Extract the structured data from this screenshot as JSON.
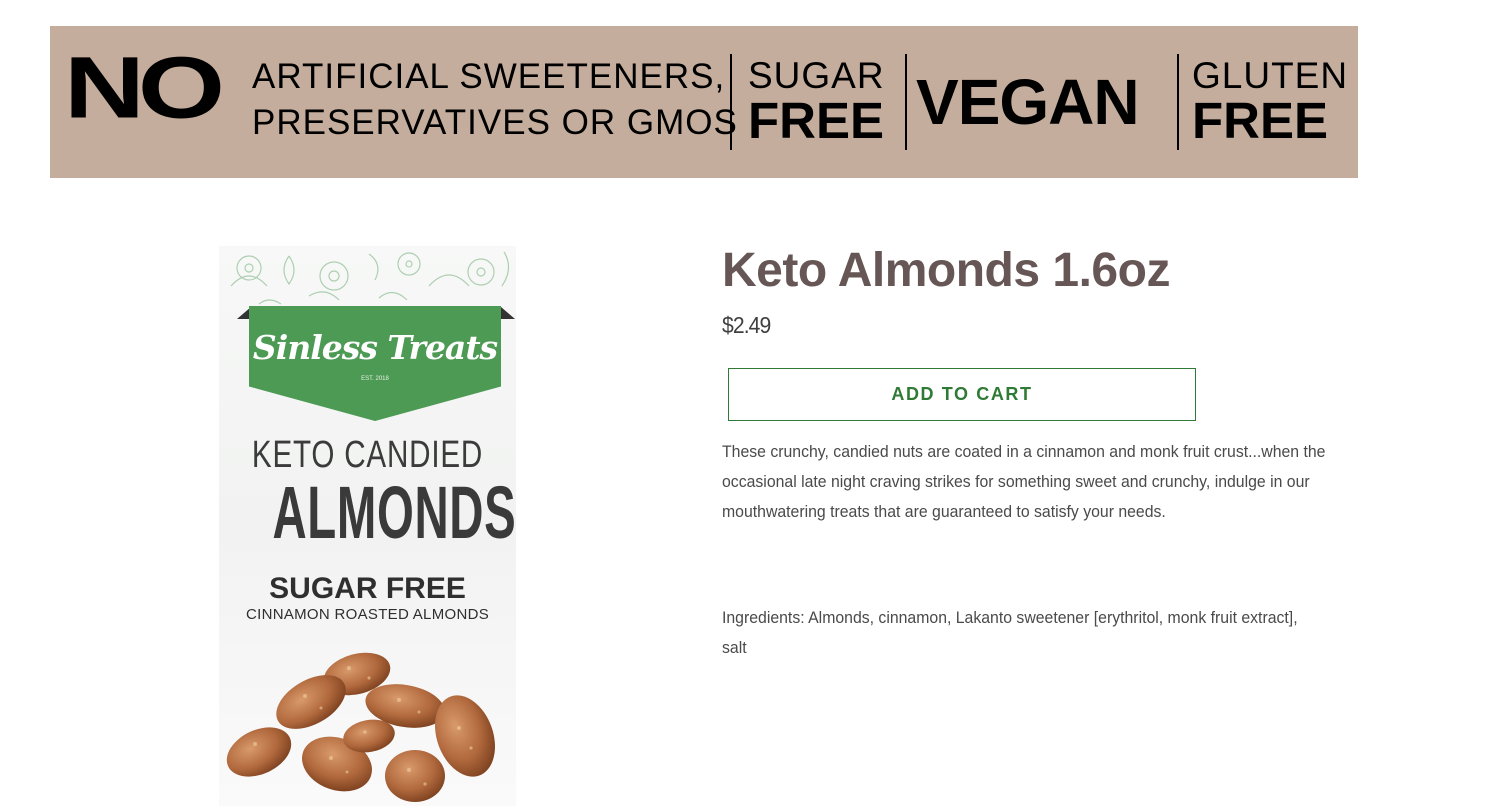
{
  "banner": {
    "no": "NO",
    "line1": "ARTIFICIAL SWEETENERS,",
    "line2": "PRESERVATIVES OR GMOS",
    "sugar_small": "SUGAR",
    "sugar_big": "FREE",
    "vegan": "VEGAN",
    "gluten_small": "GLUTEN",
    "gluten_big": "FREE",
    "background_color": "#c4ad9c"
  },
  "product_image": {
    "brand": "Sinless Treats",
    "est": "EST. 2018",
    "line1": "KETO CANDIED",
    "line2": "ALMONDS",
    "line3": "SUGAR FREE",
    "line4": "CINNAMON ROASTED ALMONDS",
    "label_color": "#4c9a53"
  },
  "product": {
    "title": "Keto Almonds 1.6oz",
    "price": "$2.49",
    "add_to_cart": "ADD TO CART",
    "description": "These crunchy, candied nuts are coated in a cinnamon and monk fruit crust...when the occasional late night craving strikes for something sweet and crunchy, indulge in our mouthwatering treats that are guaranteed to satisfy your needs.",
    "ingredients": "Ingredients: Almonds, cinnamon, Lakanto sweetener [erythritol, monk fruit extract], salt",
    "accent_color": "#2f7a35",
    "title_color": "#665655"
  }
}
